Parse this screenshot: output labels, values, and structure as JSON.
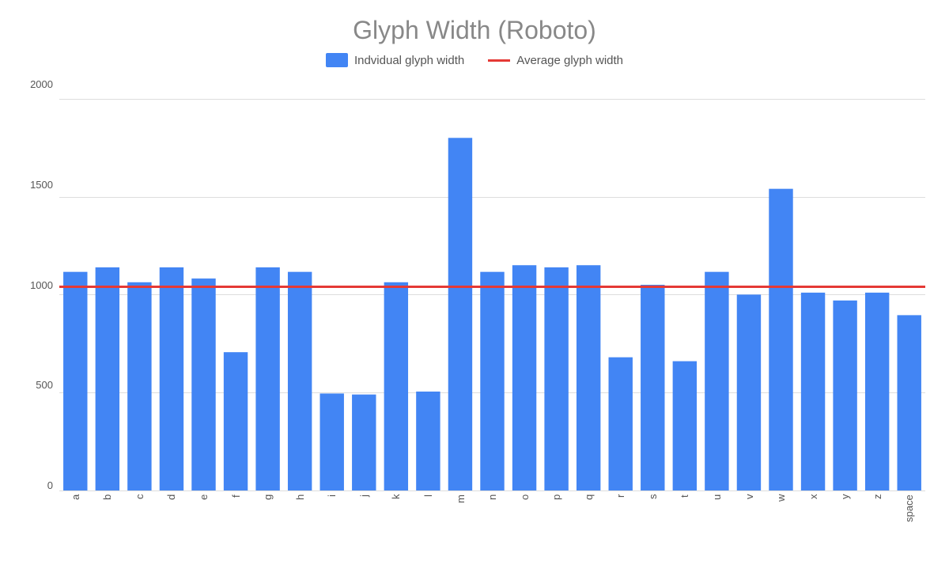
{
  "title": "Glyph Width (Roboto)",
  "legend": {
    "bar_label": "Indvidual glyph width",
    "line_label": "Average glyph width"
  },
  "colors": {
    "bar": "#4285f4",
    "average_line": "#e53935",
    "grid": "#dddddd",
    "axis_text": "#555555",
    "title": "#888888"
  },
  "y_axis": {
    "labels": [
      "0",
      "500",
      "1000",
      "1500",
      "2000"
    ],
    "max": 2100
  },
  "average_value": 1040,
  "bars": [
    {
      "label": "a",
      "value": 1116
    },
    {
      "label": "b",
      "value": 1139
    },
    {
      "label": "c",
      "value": 1063
    },
    {
      "label": "d",
      "value": 1139
    },
    {
      "label": "e",
      "value": 1082
    },
    {
      "label": "f",
      "value": 706
    },
    {
      "label": "g",
      "value": 1139
    },
    {
      "label": "h",
      "value": 1116
    },
    {
      "label": "i",
      "value": 495
    },
    {
      "label": "j",
      "value": 490
    },
    {
      "label": "k",
      "value": 1063
    },
    {
      "label": "l",
      "value": 505
    },
    {
      "label": "m",
      "value": 1800
    },
    {
      "label": "n",
      "value": 1116
    },
    {
      "label": "o",
      "value": 1150
    },
    {
      "label": "p",
      "value": 1139
    },
    {
      "label": "q",
      "value": 1150
    },
    {
      "label": "r",
      "value": 680
    },
    {
      "label": "s",
      "value": 1050
    },
    {
      "label": "t",
      "value": 660
    },
    {
      "label": "u",
      "value": 1116
    },
    {
      "label": "v",
      "value": 1000
    },
    {
      "label": "w",
      "value": 1540
    },
    {
      "label": "x",
      "value": 1010
    },
    {
      "label": "y",
      "value": 970
    },
    {
      "label": "z",
      "value": 1010
    },
    {
      "label": "space",
      "value": 895
    }
  ]
}
